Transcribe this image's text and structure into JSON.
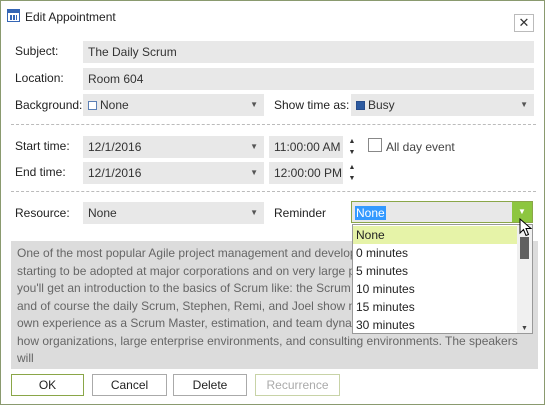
{
  "window": {
    "title": "Edit Appointment",
    "close_glyph": "✕"
  },
  "labels": {
    "subject": "Subject:",
    "location": "Location:",
    "background": "Background:",
    "show_time_as": "Show time as:",
    "start_time": "Start time:",
    "end_time": "End time:",
    "all_day_event": "All day event",
    "resource": "Resource:",
    "reminder": "Reminder"
  },
  "fields": {
    "subject": "The Daily Scrum",
    "location": "Room 604",
    "background": "None",
    "show_time_as": "Busy",
    "start_date": "12/1/2016",
    "start_time": "11:00:00 AM",
    "end_date": "12/1/2016",
    "end_time": "12:00:00 PM",
    "all_day_checked": false,
    "resource": "None",
    "reminder": "None"
  },
  "reminder_options": [
    "None",
    "0 minutes",
    "5 minutes",
    "10 minutes",
    "15 minutes",
    "30 minutes"
  ],
  "description": "One of the most popular Agile project management and development methodologies, Scrum, is starting to be adopted at major corporations and on very large projects. After reading this book, you'll get an introduction to the basics of Scrum like: the Scrum Master, team, product owner, and of course the daily Scrum, Stephen, Remi, and Joel show many methodology drawn from his own experience as a Scrum Master, estimation, and team dynamics are all discussed as well as how organizations, large enterprise environments, and consulting environments. The speakers will",
  "buttons": {
    "ok": "OK",
    "cancel": "Cancel",
    "delete": "Delete",
    "recurrence": "Recurrence"
  },
  "colors": {
    "accent": "#8dc63f",
    "selection": "#3399ff",
    "busy": "#2c5aa0"
  }
}
